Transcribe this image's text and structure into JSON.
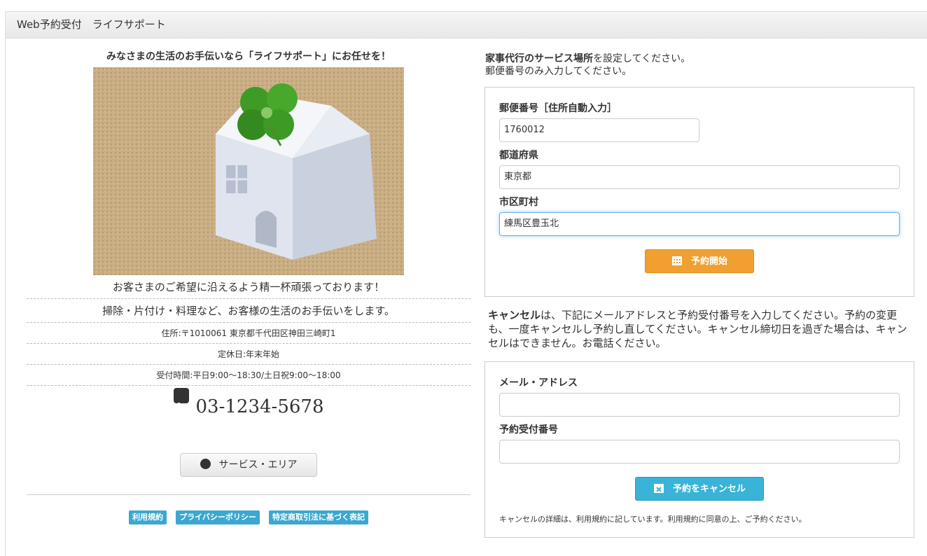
{
  "header": {
    "title": "Web予約受付　ライフサポート"
  },
  "left": {
    "tagline": "みなさまの生活のお手伝いなら「ライフサポート」にお任せを！",
    "lines": [
      "お客さまのご希望に沿えるよう精一杯頑張っております！",
      "掃除・片付け・料理など、お客様の生活のお手伝いをします。",
      "住所:〒1010061 東京都千代田区神田三崎町1",
      "定休日:年末年始",
      "受付時間:平日9:00～18:30/土日祝9:00～18:00"
    ],
    "phone": "03-1234-5678",
    "area_button": "サービス・エリア",
    "footer_links": [
      "利用規約",
      "プライバシーポリシー",
      "特定商取引法に基づく表記"
    ]
  },
  "reserve": {
    "intro_bold": "家事代行のサービス場所",
    "intro_rest": "を設定してください。",
    "intro_line2": "郵便番号のみ入力してください。",
    "postal_label": "郵便番号［住所自動入力］",
    "postal_value": "1760012",
    "pref_label": "都道府県",
    "pref_value": "東京都",
    "city_label": "市区町村",
    "city_value": "練馬区豊玉北",
    "start_button": "予約開始"
  },
  "cancel": {
    "intro_bold": "キャンセル",
    "intro_rest": "は、下記にメールアドレスと予約受付番号を入力してください。予約の変更も、一度キャンセルし予約し直してください。キャンセル締切日を過ぎた場合は、キャンセルはできません。お電話ください。",
    "email_label": "メール・アドレス",
    "email_value": "",
    "number_label": "予約受付番号",
    "number_value": "",
    "cancel_button": "予約をキャンセル",
    "note": "キャンセルの詳細は、利用規約に記しています。利用規約に同意の上、ご予約ください。"
  },
  "colors": {
    "orange": "#f0a030",
    "blue": "#39b3d7",
    "label_blue": "#3aa8d0"
  }
}
